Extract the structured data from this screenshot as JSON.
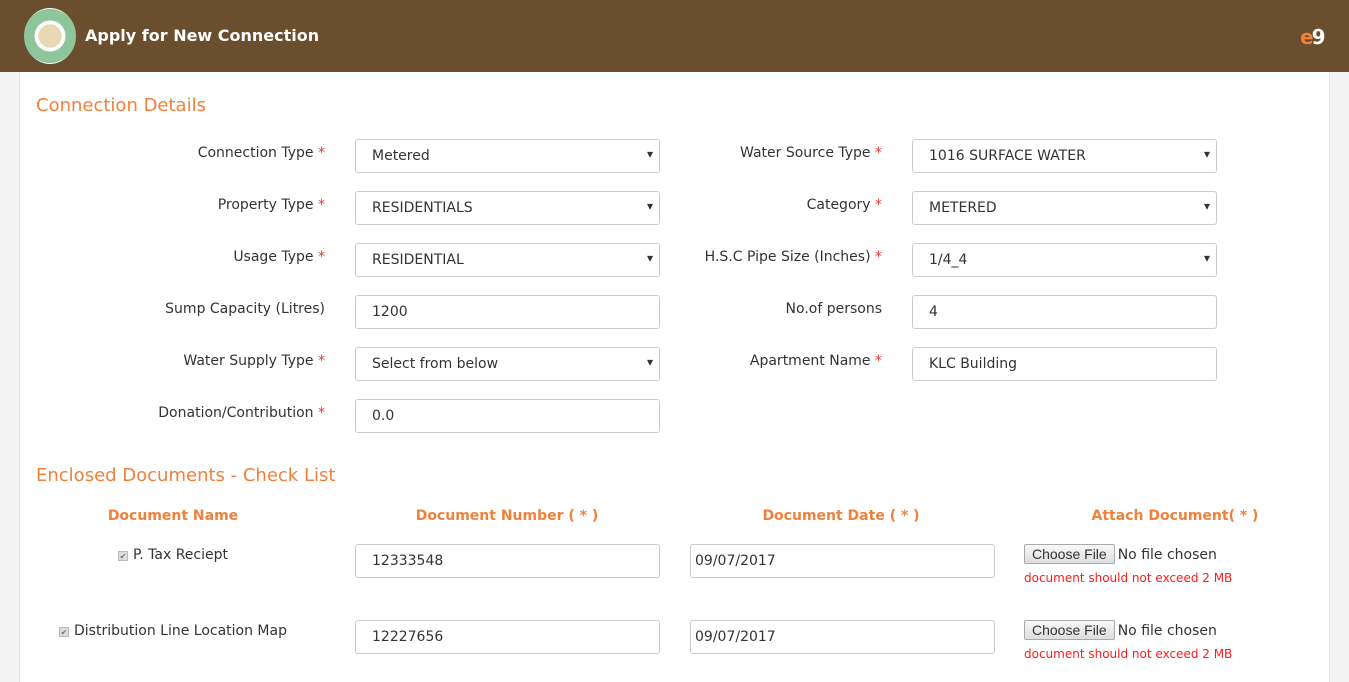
{
  "header": {
    "title": "Apply for New Connection",
    "brand": "e9",
    "colors": {
      "bg": "#6b4e2d",
      "accent": "#f0813a"
    }
  },
  "connection": {
    "title": "Connection Details",
    "left": [
      {
        "label": "Connection Type",
        "req": true,
        "value": "Metered",
        "select": true
      },
      {
        "label": "Property Type",
        "req": true,
        "value": "RESIDENTIALS",
        "select": true
      },
      {
        "label": "Usage Type",
        "req": true,
        "value": "RESIDENTIAL",
        "select": true
      },
      {
        "label": "Sump Capacity (Litres)",
        "req": false,
        "value": "1200",
        "select": false
      },
      {
        "label": "Water Supply Type",
        "req": true,
        "value": "Select from below",
        "select": true
      },
      {
        "label": "Donation/Contribution",
        "req": true,
        "value": "0.0",
        "select": false
      }
    ],
    "right": [
      {
        "label": "Water Source Type",
        "req": true,
        "value": "1016 SURFACE WATER",
        "select": true
      },
      {
        "label": "Category",
        "req": true,
        "value": "METERED",
        "select": true
      },
      {
        "label": "H.S.C Pipe Size (Inches)",
        "req": true,
        "value": "1/4_4",
        "select": true
      },
      {
        "label": "No.of persons",
        "req": false,
        "value": "4",
        "select": false
      },
      {
        "label": "Apartment Name",
        "req": true,
        "value": "KLC Building",
        "select": false
      }
    ]
  },
  "documents": {
    "title": "Enclosed Documents - Check List",
    "headers": [
      "Document Name",
      "Document Number ( * )",
      "Document Date ( * )",
      "Attach Document( * )"
    ],
    "rows": [
      {
        "name": "P. Tax Reciept",
        "number": "12333548",
        "date": "09/07/2017"
      },
      {
        "name": "Distribution Line Location Map",
        "number": "12227656",
        "date": "09/07/2017"
      }
    ],
    "choose_label": "Choose File",
    "no_file": "No file chosen",
    "error": "document should not exceed 2 MB"
  }
}
